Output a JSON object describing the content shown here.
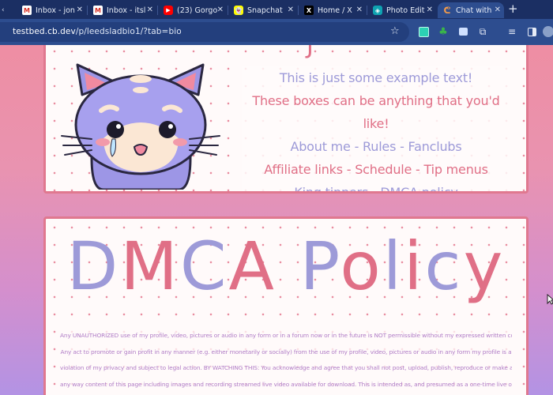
{
  "browser": {
    "tabs": [
      {
        "title": "Inbox - jon",
        "icon": "gmail-icon",
        "glyph": "M",
        "active": false
      },
      {
        "title": "Inbox - itsl",
        "icon": "gmail-icon",
        "glyph": "M",
        "active": false
      },
      {
        "title": "(23) Gorgo",
        "icon": "youtube-icon",
        "glyph": "▶",
        "active": false
      },
      {
        "title": "Snapchat",
        "icon": "snapchat-icon",
        "glyph": "👻",
        "active": false
      },
      {
        "title": "Home / X",
        "icon": "x-logo-icon",
        "glyph": "X",
        "active": false
      },
      {
        "title": "Photo Edit",
        "icon": "photo-editor-icon",
        "glyph": "◈",
        "active": false
      },
      {
        "title": "Chat with",
        "icon": "chaturbate-icon",
        "glyph": "ᕦ",
        "active": true
      }
    ],
    "new_tab_label": "+",
    "close_glyph": "✕",
    "address": {
      "host": "testbed.cb.dev",
      "path": "/p/leedsladbio1/?tab=bio"
    },
    "bookmark_glyph": "☆",
    "toolbar_icons": [
      "extension-icon",
      "extension-icon",
      "extension-icon",
      "puzzle-icon",
      "reading-queue-icon",
      "side-panel-icon",
      "profile-avatar-icon"
    ]
  },
  "bio_panel": {
    "top_glyph": "J",
    "lines": [
      {
        "text": "This is just some example text!",
        "color": "lavender"
      },
      {
        "text": "These boxes can be anything that you'd like!",
        "color": "pink"
      },
      {
        "text": "About me - Rules - Fanclubs",
        "color": "lavender"
      },
      {
        "text": "Affiliate links - Schedule - Tip menus",
        "color": "pink"
      },
      {
        "text": "King tippers - DMCA policy",
        "color": "lavender"
      }
    ]
  },
  "dmca_panel": {
    "title": "DMCA Policy",
    "body": [
      "Any UNAUTHORIZED use of my profile, video, pictures or audio in any form or in a forum now or in the future is NOT permissible without my expressed written consent.",
      "Any act to promote or gain profit in any manner (e.g. either monetarily or socially) from the use of my profile, video, pictures or audio in any form my profile is a",
      "violation of my privacy and subject to legal action. BY WATCHING THIS: You acknowledge and agree that you shall not post, upload, publish, reproduce or make available in",
      "any way content of this page including images and recording streamed live video available for download. This is intended as, and presumed as a one-time live one"
    ]
  },
  "colors": {
    "lavender": "#9d9ad8",
    "pink": "#e06f86",
    "tab_bar": "#1b2f63",
    "toolbar": "#2d4d8f",
    "panel_border": "#e0788f"
  }
}
